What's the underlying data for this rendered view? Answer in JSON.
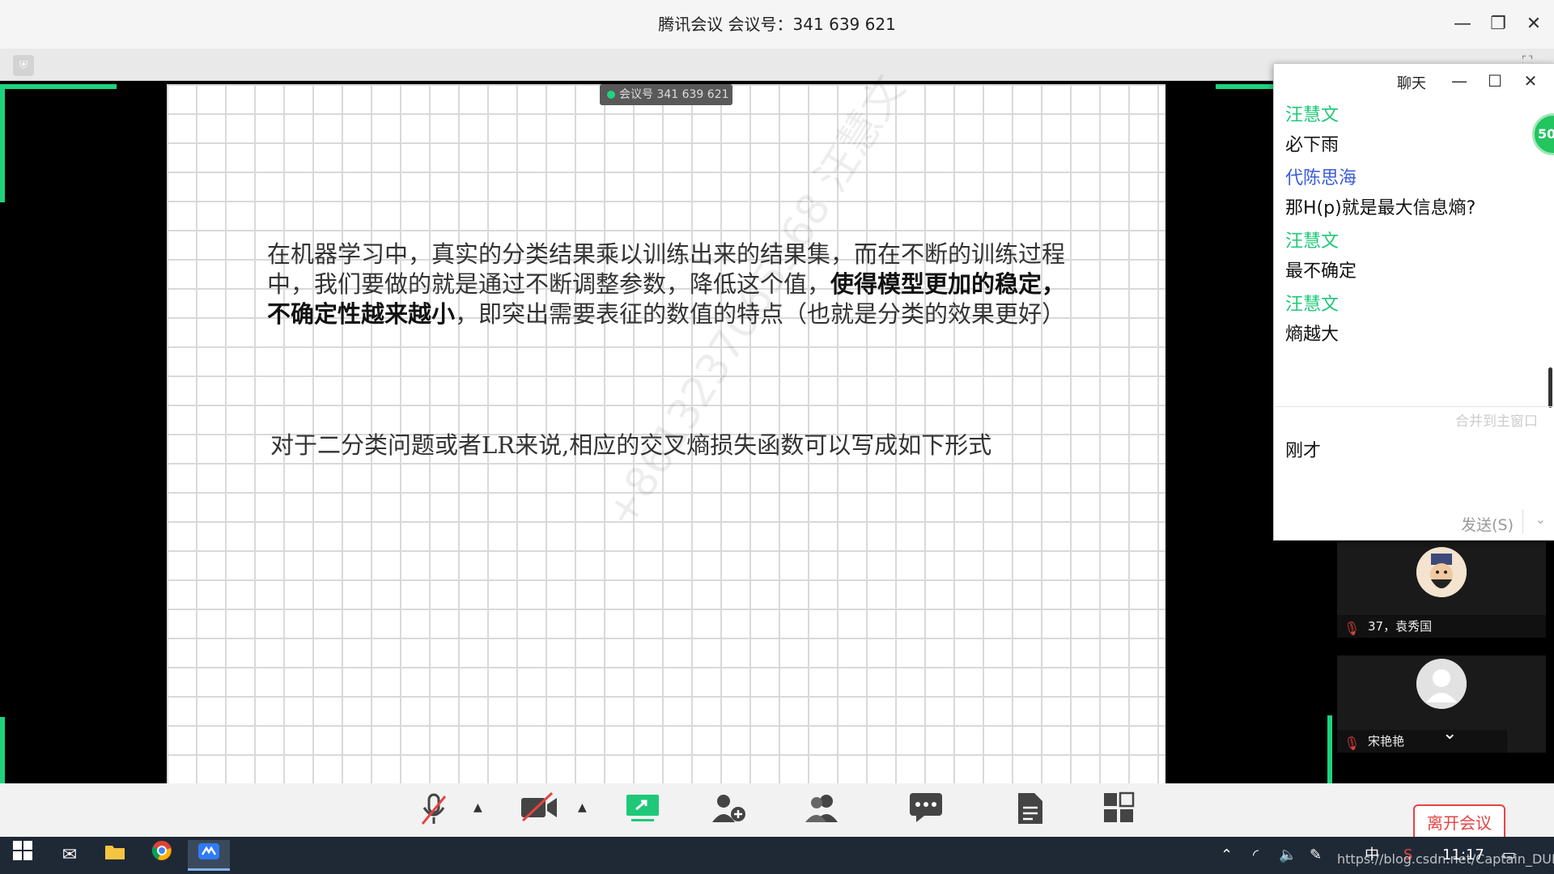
{
  "window": {
    "title": "腾讯会议 会议号：341 639 621",
    "minimize": "—",
    "restore": "❐",
    "close": "✕"
  },
  "subbar": {
    "shield_icon": "shield-icon",
    "fullscreen_icon": "fullscreen-icon"
  },
  "slide": {
    "meeting_tag": "会议号 341 639 621",
    "para1_a": "在机器学习中，真实的分类结果乘以训练出来的结果集，而在不断的训练过程中，我们要做的就是通过不断调整参数，降低这个值，",
    "para1_bold": "使得模型更加的稳定，不确定性越来越小",
    "para1_b": "，即突出需要表征的数值的特点（也就是分类的效果更好）",
    "para2": "对于二分类问题或者LR来说,相应的交叉熵损失函数可以写成如下形式",
    "watermark": "+8613237065568 汪慧文"
  },
  "chat": {
    "title": "聊天",
    "minimize": "—",
    "maximize": "☐",
    "close": "✕",
    "messages": [
      {
        "sender": "汪慧文",
        "text": "必下雨",
        "color": "#1ec878"
      },
      {
        "sender": "代陈思海",
        "text": "那H(p)就是最大信息熵?",
        "color": "#3b5bdb"
      },
      {
        "sender": "汪慧文",
        "text": "最不确定",
        "color": "#1ec878"
      },
      {
        "sender": "汪慧文",
        "text": "熵越大",
        "color": "#1ec878"
      }
    ],
    "merge_label": "合并到主窗口",
    "input_value": "刚才",
    "send_label": "发送(S)",
    "send_dropdown": "⌄"
  },
  "badge": "50",
  "participants": [
    {
      "name": "37，袁秀国",
      "avatar": "avatar-cartoon"
    },
    {
      "name": "宋艳艳",
      "avatar": "avatar-default"
    }
  ],
  "tile_expand": "⌄",
  "toolbar": {
    "icons": [
      "mic-muted-icon",
      "video-off-icon",
      "share-screen-icon",
      "invite-icon",
      "members-icon",
      "chat-icon",
      "document-icon",
      "apps-icon"
    ],
    "leave_label": "离开会议"
  },
  "taskbar": {
    "ime": "中",
    "time": "11:17",
    "url_overlay": "https://blog.csdn.net/Captain_DUDU"
  },
  "colors": {
    "accent_green": "#1ed37e",
    "leave_red": "#e64343"
  }
}
